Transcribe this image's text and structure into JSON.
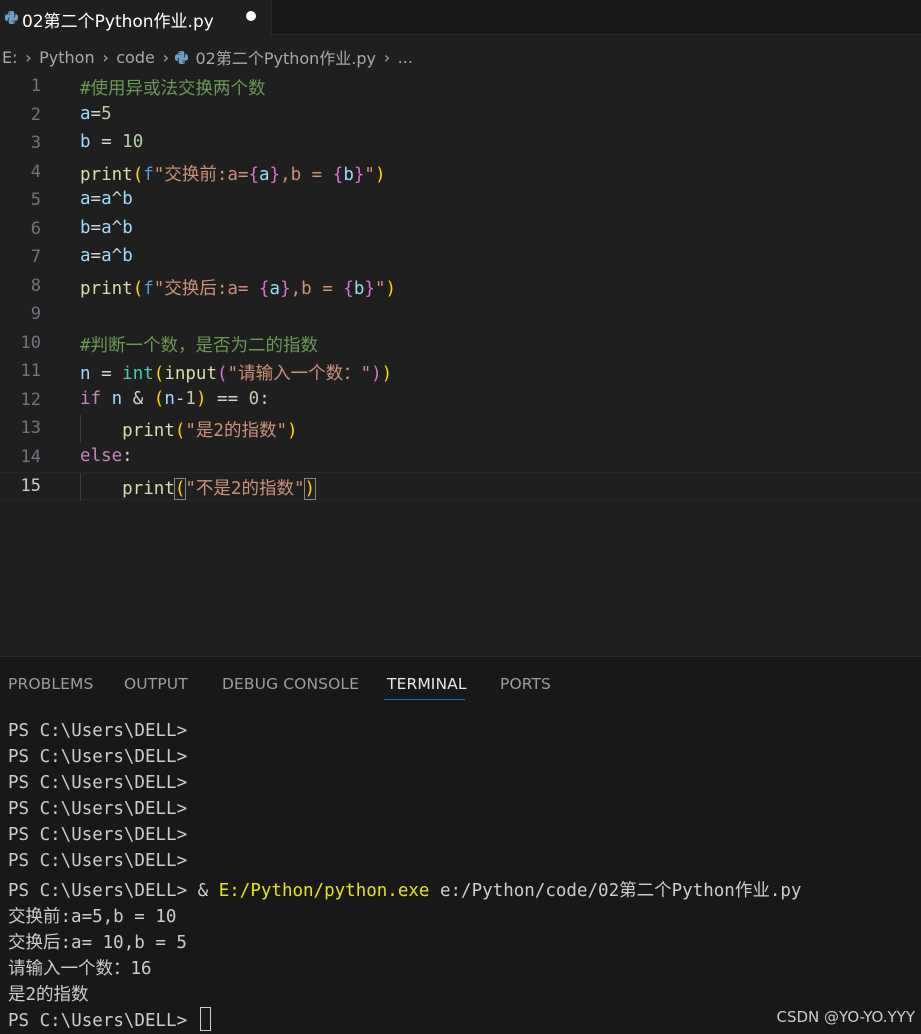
{
  "tab": {
    "filename": "02第二个Python作业.py",
    "icon": "python-icon",
    "modified": true
  },
  "breadcrumb": {
    "drive": "E:",
    "folder1": "Python",
    "folder2": "code",
    "file": "02第二个Python作业.py",
    "more": "..."
  },
  "editor": {
    "current_line": 15,
    "lines": [
      {
        "n": "1",
        "tokens": [
          {
            "t": "#使用异或法交换两个数",
            "c": "comment"
          }
        ]
      },
      {
        "n": "2",
        "tokens": [
          {
            "t": "a",
            "c": "var"
          },
          {
            "t": "=",
            "c": "op"
          },
          {
            "t": "5",
            "c": "num"
          }
        ]
      },
      {
        "n": "3",
        "tokens": [
          {
            "t": "b",
            "c": "var"
          },
          {
            "t": " = ",
            "c": "op"
          },
          {
            "t": "10",
            "c": "num"
          }
        ]
      },
      {
        "n": "4",
        "tokens": [
          {
            "t": "print",
            "c": "fn"
          },
          {
            "t": "(",
            "c": "b1"
          },
          {
            "t": "f",
            "c": "f"
          },
          {
            "t": "\"交换前:a=",
            "c": "str"
          },
          {
            "t": "{",
            "c": "b2"
          },
          {
            "t": "a",
            "c": "var"
          },
          {
            "t": "}",
            "c": "b2"
          },
          {
            "t": ",b = ",
            "c": "str"
          },
          {
            "t": "{",
            "c": "b2"
          },
          {
            "t": "b",
            "c": "var"
          },
          {
            "t": "}",
            "c": "b2"
          },
          {
            "t": "\"",
            "c": "str"
          },
          {
            "t": ")",
            "c": "b1"
          }
        ]
      },
      {
        "n": "5",
        "tokens": [
          {
            "t": "a",
            "c": "var"
          },
          {
            "t": "=",
            "c": "op"
          },
          {
            "t": "a",
            "c": "var"
          },
          {
            "t": "^",
            "c": "op"
          },
          {
            "t": "b",
            "c": "var"
          }
        ]
      },
      {
        "n": "6",
        "tokens": [
          {
            "t": "b",
            "c": "var"
          },
          {
            "t": "=",
            "c": "op"
          },
          {
            "t": "a",
            "c": "var"
          },
          {
            "t": "^",
            "c": "op"
          },
          {
            "t": "b",
            "c": "var"
          }
        ]
      },
      {
        "n": "7",
        "tokens": [
          {
            "t": "a",
            "c": "var"
          },
          {
            "t": "=",
            "c": "op"
          },
          {
            "t": "a",
            "c": "var"
          },
          {
            "t": "^",
            "c": "op"
          },
          {
            "t": "b",
            "c": "var"
          }
        ]
      },
      {
        "n": "8",
        "tokens": [
          {
            "t": "print",
            "c": "fn"
          },
          {
            "t": "(",
            "c": "b1"
          },
          {
            "t": "f",
            "c": "f"
          },
          {
            "t": "\"交换后:a= ",
            "c": "str"
          },
          {
            "t": "{",
            "c": "b2"
          },
          {
            "t": "a",
            "c": "var"
          },
          {
            "t": "}",
            "c": "b2"
          },
          {
            "t": ",b = ",
            "c": "str"
          },
          {
            "t": "{",
            "c": "b2"
          },
          {
            "t": "b",
            "c": "var"
          },
          {
            "t": "}",
            "c": "b2"
          },
          {
            "t": "\"",
            "c": "str"
          },
          {
            "t": ")",
            "c": "b1"
          }
        ]
      },
      {
        "n": "9",
        "tokens": []
      },
      {
        "n": "10",
        "tokens": [
          {
            "t": "#判断一个数，是否为二的指数",
            "c": "comment"
          }
        ]
      },
      {
        "n": "11",
        "tokens": [
          {
            "t": "n",
            "c": "var"
          },
          {
            "t": " = ",
            "c": "op"
          },
          {
            "t": "int",
            "c": "builtin"
          },
          {
            "t": "(",
            "c": "b1"
          },
          {
            "t": "input",
            "c": "fn"
          },
          {
            "t": "(",
            "c": "b2"
          },
          {
            "t": "\"请输入一个数：\"",
            "c": "str"
          },
          {
            "t": ")",
            "c": "b2"
          },
          {
            "t": ")",
            "c": "b1"
          }
        ]
      },
      {
        "n": "12",
        "tokens": [
          {
            "t": "if",
            "c": "kw"
          },
          {
            "t": " ",
            "c": "op"
          },
          {
            "t": "n",
            "c": "var"
          },
          {
            "t": " & ",
            "c": "op"
          },
          {
            "t": "(",
            "c": "b1"
          },
          {
            "t": "n",
            "c": "var"
          },
          {
            "t": "-",
            "c": "op"
          },
          {
            "t": "1",
            "c": "num"
          },
          {
            "t": ")",
            "c": "b1"
          },
          {
            "t": " == ",
            "c": "op"
          },
          {
            "t": "0",
            "c": "num"
          },
          {
            "t": ":",
            "c": "op"
          }
        ]
      },
      {
        "n": "13",
        "indent": true,
        "tokens": [
          {
            "t": "    ",
            "c": "op"
          },
          {
            "t": "print",
            "c": "fn"
          },
          {
            "t": "(",
            "c": "b1"
          },
          {
            "t": "\"是2的指数\"",
            "c": "str"
          },
          {
            "t": ")",
            "c": "b1"
          }
        ]
      },
      {
        "n": "14",
        "tokens": [
          {
            "t": "else",
            "c": "kw"
          },
          {
            "t": ":",
            "c": "op"
          }
        ]
      },
      {
        "n": "15",
        "indent": true,
        "tokens": [
          {
            "t": "    ",
            "c": "op"
          },
          {
            "t": "print",
            "c": "fn"
          },
          {
            "t": "(",
            "c": "b1",
            "match": true
          },
          {
            "t": "\"不是2的指数\"",
            "c": "str"
          },
          {
            "t": ")",
            "c": "b1",
            "match": true
          }
        ]
      }
    ]
  },
  "panel": {
    "tabs": [
      "PROBLEMS",
      "OUTPUT",
      "DEBUG CONSOLE",
      "TERMINAL",
      "PORTS"
    ],
    "active_tab": "TERMINAL",
    "terminal": {
      "prompt": "PS C:\\Users\\DELL>",
      "empty_prompt_count": 6,
      "command_amp": " & ",
      "command_exe": "E:/Python/python.exe",
      "command_arg": " e:/Python/code/02第二个Python作业.py",
      "output": [
        "交换前:a=5,b = 10",
        "交换后:a= 10,b = 5",
        "请输入一个数：16",
        "是2的指数"
      ],
      "final_prompt": "PS C:\\Users\\DELL> "
    }
  },
  "watermark": "CSDN @YO-YO.YYY",
  "colors": {
    "editor_bg": "#1f1f1f",
    "panel_bg": "#181818",
    "comment": "#6a9955",
    "variable": "#9cdcfe",
    "number": "#b5cea8",
    "function": "#dcdcaa",
    "string": "#ce9178",
    "keyword": "#c586c0",
    "builtin": "#4ec9b0",
    "f_prefix": "#569cd6",
    "bracket1": "#ffd700",
    "bracket2": "#da70d6",
    "accent": "#0078d4",
    "terminal_exe": "#e5e510"
  }
}
